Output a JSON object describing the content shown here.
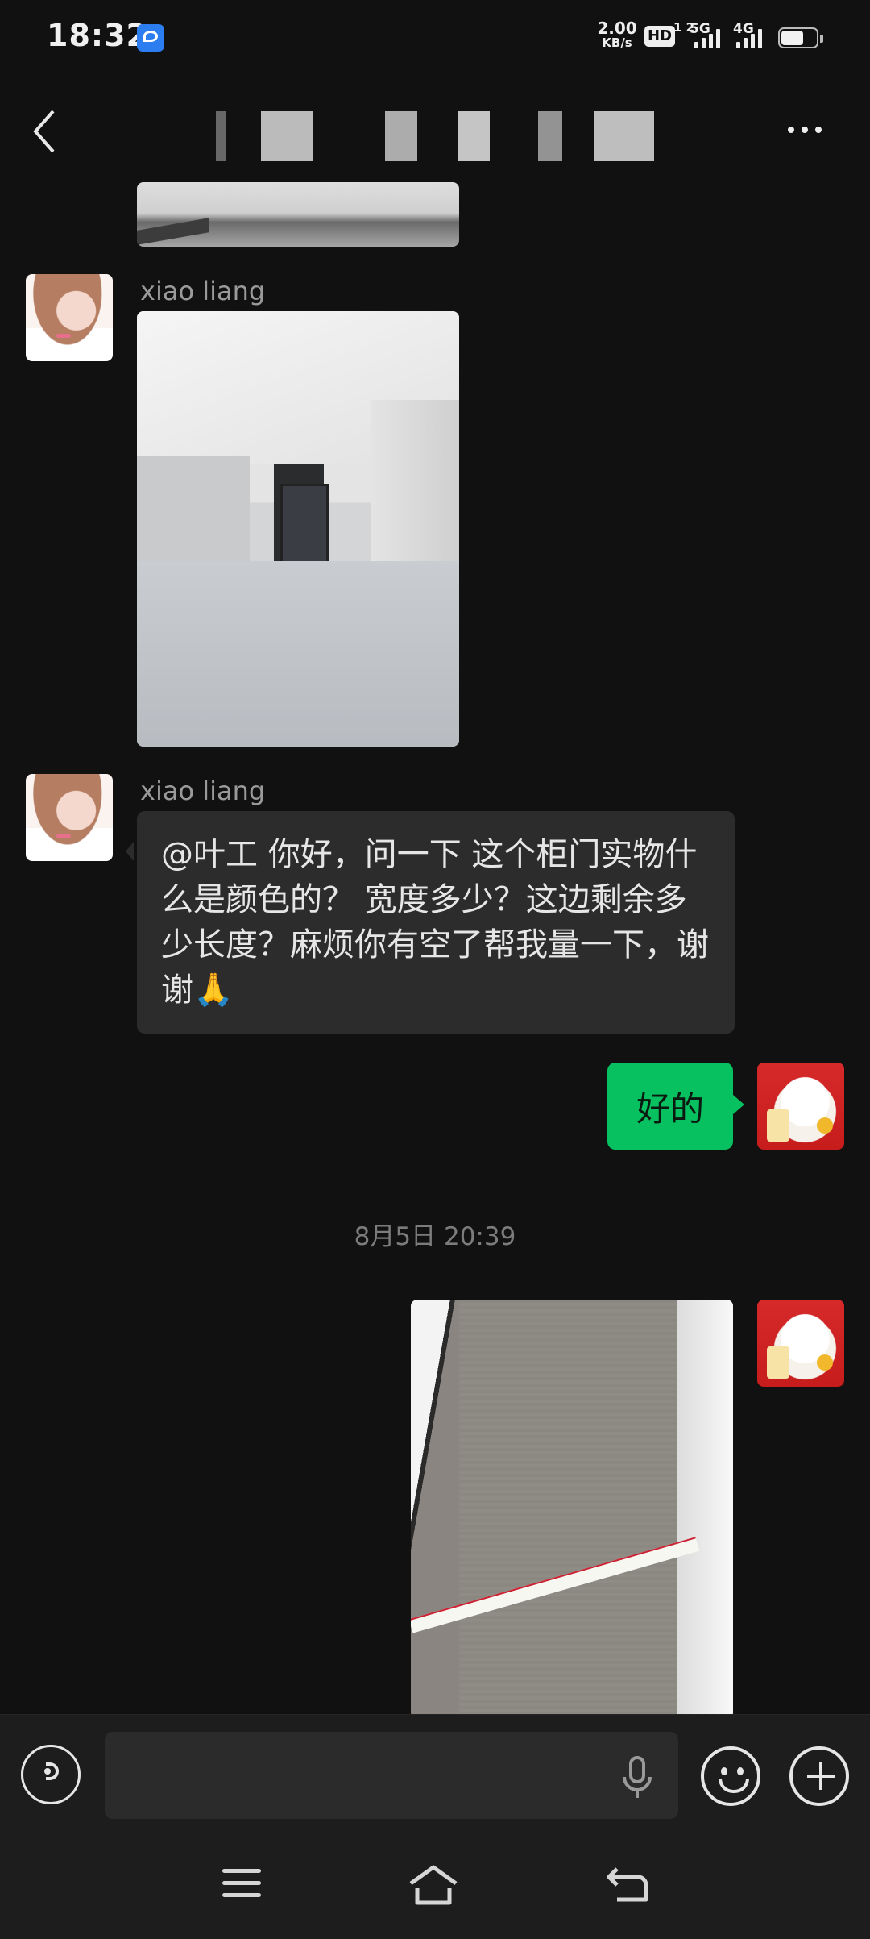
{
  "status_bar": {
    "time": "18:32",
    "net_speed_value": "2.00",
    "net_speed_unit": "KB/s",
    "hd_label": "HD",
    "hd_super": "1 2",
    "sig1_label": "5G",
    "sig2_label": "4G",
    "battery_level": 0.65
  },
  "header": {
    "title": ""
  },
  "messages": [
    {
      "type": "image",
      "sender": ""
    },
    {
      "type": "image",
      "sender": "xiao  liang"
    },
    {
      "type": "text",
      "sender": "xiao  liang",
      "text": "@叶工  你好，问一下 这个柜门实物什么是颜色的？ 宽度多少？这边剩余多少长度？麻烦你有空了帮我量一下，谢谢🙏"
    },
    {
      "type": "text",
      "sender": "me",
      "text": "好的"
    },
    {
      "type": "timestamp",
      "text": "8月5日 20:39"
    },
    {
      "type": "image",
      "sender": "me"
    }
  ],
  "input_bar": {
    "placeholder": ""
  },
  "colors": {
    "background": "#111111",
    "bubble_left": "#2c2c2c",
    "bubble_right": "#07c160",
    "input_bar": "#1d1d1d"
  },
  "icons": [
    "back-icon",
    "more-icon",
    "voice-icon",
    "mic-icon",
    "emoji-icon",
    "plus-icon",
    "menu-icon",
    "home-icon",
    "return-icon"
  ]
}
